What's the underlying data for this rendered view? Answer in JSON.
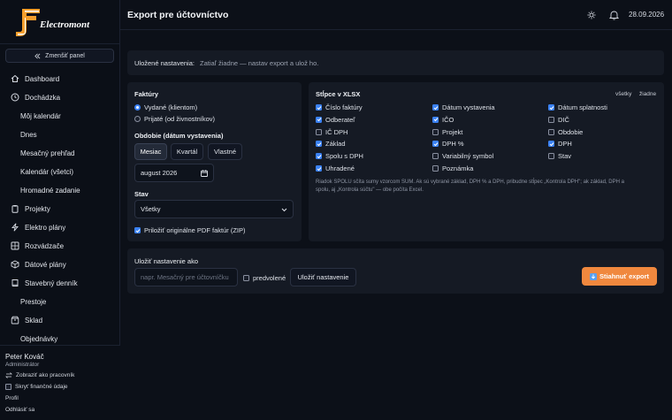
{
  "app": {
    "brand": "Electromont",
    "page_title": "Export pre účtovníctvo",
    "date": "28.09.2026",
    "accent": "#3b82f6",
    "primary_button_color": "#f0883e"
  },
  "sidebar": {
    "shrink_label": "Zmenšiť panel",
    "items": [
      {
        "label": "Dashboard",
        "icon": "home-icon"
      },
      {
        "label": "Dochádzka",
        "icon": "clock-icon"
      },
      {
        "label": "Môj kalendár"
      },
      {
        "label": "Dnes"
      },
      {
        "label": "Mesačný prehľad"
      },
      {
        "label": "Kalendár (všetci)"
      },
      {
        "label": "Hromadné zadanie"
      },
      {
        "label": "Projekty",
        "icon": "clipboard-icon"
      },
      {
        "label": "Elektro plány",
        "icon": "bolt-icon"
      },
      {
        "label": "Rozvádzače",
        "icon": "grid-icon"
      },
      {
        "label": "Dátové plány",
        "icon": "cube-icon"
      },
      {
        "label": "Stavebný denník",
        "icon": "book-icon"
      },
      {
        "label": "Prestoje"
      },
      {
        "label": "Sklad",
        "icon": "box-icon"
      },
      {
        "label": "Objednávky"
      }
    ],
    "user": {
      "name": "Peter Kováč",
      "role": "Administrátor"
    },
    "view_as_worker": "Zobraziť ako pracovník",
    "hide_financial": "Skryť finančné údaje",
    "profile": "Profil",
    "logout": "Odhlásiť sa"
  },
  "saved": {
    "label": "Uložené nastavenia:",
    "value": "Zatiaľ žiadne — nastav export a ulož ho."
  },
  "invoices": {
    "title": "Faktúry",
    "issued": "Vydané (klientom)",
    "received": "Prijaté (od živnostníkov)",
    "period_title": "Obdobie (dátum vystavenia)",
    "period_tabs": [
      "Mesiac",
      "Kvartál",
      "Vlastné"
    ],
    "month_value": "august 2026",
    "status_title": "Stav",
    "status_value": "Všetky",
    "attach_pdf": "Priložiť originálne PDF faktúr (ZIP)"
  },
  "columns": {
    "title": "Stĺpce v XLSX",
    "all": "všetky",
    "none": "žiadne",
    "col1": [
      {
        "label": "Číslo faktúry",
        "checked": true
      },
      {
        "label": "Odberateľ",
        "checked": true
      },
      {
        "label": "IČ DPH",
        "checked": false
      },
      {
        "label": "Základ",
        "checked": true
      },
      {
        "label": "Spolu s DPH",
        "checked": true
      },
      {
        "label": "Uhradené",
        "checked": true
      }
    ],
    "col2": [
      {
        "label": "Dátum vystavenia",
        "checked": true
      },
      {
        "label": "IČO",
        "checked": true
      },
      {
        "label": "Projekt",
        "checked": false
      },
      {
        "label": "DPH %",
        "checked": true
      },
      {
        "label": "Variabilný symbol",
        "checked": false
      },
      {
        "label": "Poznámka",
        "checked": false
      }
    ],
    "col3": [
      {
        "label": "Dátum splatnosti",
        "checked": true
      },
      {
        "label": "DIČ",
        "checked": false
      },
      {
        "label": "Obdobie",
        "checked": false
      },
      {
        "label": "DPH",
        "checked": true
      },
      {
        "label": "Stav",
        "checked": false
      }
    ],
    "note_line1": "Riadok SPOLU sčíta sumy vzorcom SUM. Ak sú vybrané základ, DPH % a DPH, pribudne stĺpec „Kontrola DPH\"; ak základ, DPH a",
    "note_line2": "spolu, aj „Kontrola súčtu\" — obe počíta Excel."
  },
  "save_config": {
    "title": "Uložiť nastavenie ako",
    "placeholder": "napr. Mesačný pre účtovníčku",
    "default_label": "predvolené",
    "save_button": "Uložiť nastavenie",
    "download_button": "Stiahnuť export"
  }
}
